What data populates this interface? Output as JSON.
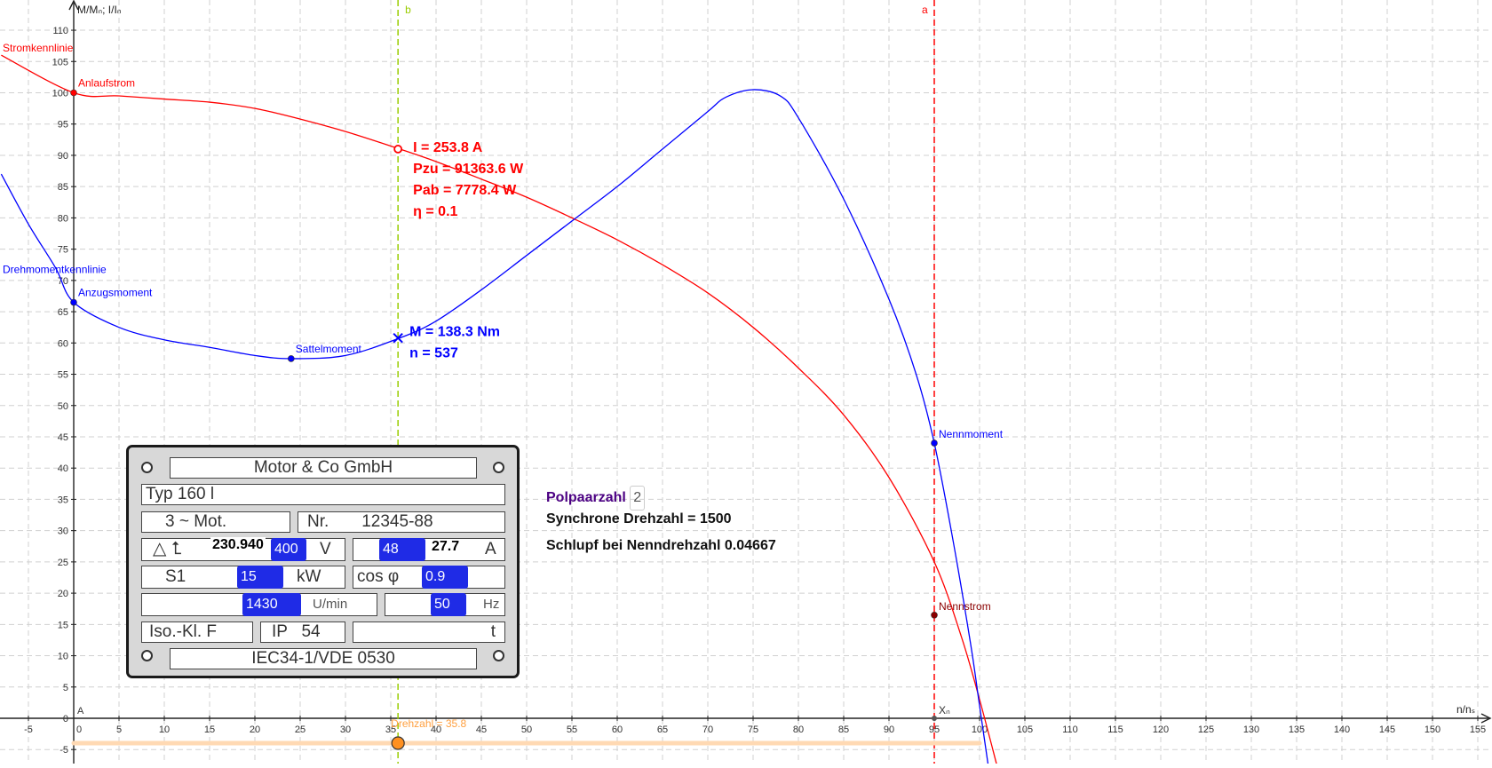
{
  "axes": {
    "y_label": "M/Mₙ; I/Iₙ",
    "x_label": "n/nₛ",
    "origin_label": "A",
    "x_range": [
      -8,
      157
    ],
    "y_range": [
      -8,
      114
    ],
    "x_ticks": [
      -5,
      0,
      5,
      10,
      15,
      20,
      25,
      30,
      35,
      40,
      45,
      50,
      55,
      60,
      65,
      70,
      75,
      80,
      85,
      90,
      95,
      100,
      105,
      110,
      115,
      120,
      125,
      130,
      135,
      140,
      145,
      150,
      155
    ],
    "y_ticks": [
      -5,
      0,
      5,
      10,
      15,
      20,
      25,
      30,
      35,
      40,
      45,
      50,
      55,
      60,
      65,
      70,
      75,
      80,
      85,
      90,
      95,
      100,
      105,
      110
    ]
  },
  "colors": {
    "current": "#ff0000",
    "torque": "#0000ff",
    "line_b": "#99cc00",
    "line_a": "#ff0000",
    "slider": "#ffa040",
    "polpaar": "#4b0082"
  },
  "curves": {
    "current": {
      "name": "Stromkennlinie",
      "points": [
        [
          -8,
          106
        ],
        [
          0,
          100
        ],
        [
          5,
          99.5
        ],
        [
          10,
          99
        ],
        [
          15,
          98.5
        ],
        [
          20,
          97.5
        ],
        [
          25,
          95.8
        ],
        [
          30,
          93.8
        ],
        [
          36,
          91
        ],
        [
          40,
          89
        ],
        [
          45,
          86.2
        ],
        [
          50,
          83.3
        ],
        [
          55,
          80
        ],
        [
          60,
          76.5
        ],
        [
          65,
          72.5
        ],
        [
          70,
          68
        ],
        [
          75,
          62.5
        ],
        [
          80,
          56
        ],
        [
          85,
          48.5
        ],
        [
          90,
          38.5
        ],
        [
          95,
          25
        ],
        [
          98,
          13
        ],
        [
          100,
          3
        ],
        [
          102,
          -8
        ]
      ]
    },
    "torque": {
      "name": "Drehmomentkennlinie",
      "points": [
        [
          -8,
          87
        ],
        [
          -5,
          79
        ],
        [
          -2,
          72
        ],
        [
          0,
          66.5
        ],
        [
          5,
          62.5
        ],
        [
          10,
          60.5
        ],
        [
          15,
          59.3
        ],
        [
          20,
          58
        ],
        [
          24,
          57.5
        ],
        [
          30,
          58
        ],
        [
          36,
          60.8
        ],
        [
          40,
          63.5
        ],
        [
          45,
          68.5
        ],
        [
          50,
          74
        ],
        [
          55,
          79.5
        ],
        [
          60,
          85
        ],
        [
          65,
          91
        ],
        [
          70,
          97
        ],
        [
          72,
          99.3
        ],
        [
          75,
          100.5
        ],
        [
          78,
          99.5
        ],
        [
          80,
          96
        ],
        [
          85,
          83
        ],
        [
          90,
          67
        ],
        [
          93,
          55
        ],
        [
          95,
          44
        ],
        [
          97,
          29
        ],
        [
          99,
          12
        ],
        [
          100,
          2
        ],
        [
          101,
          -8
        ]
      ]
    }
  },
  "points": {
    "anlaufstrom": {
      "label": "Anlaufstrom",
      "x": 0,
      "y": 100
    },
    "anzugsmoment": {
      "label": "Anzugsmoment",
      "x": 0,
      "y": 66.5
    },
    "sattelmoment": {
      "label": "Sattelmoment",
      "x": 24,
      "y": 57.5
    },
    "nennmoment": {
      "label": "Nennmoment",
      "x": 95,
      "y": 44
    },
    "nennstrom": {
      "label": "Nennstrom",
      "x": 95,
      "y": 16.5
    },
    "xn": {
      "label": "Xₙ",
      "x": 95,
      "y": 0
    },
    "current_marker": {
      "x": 35.8,
      "y": 91
    },
    "torque_marker": {
      "x": 35.8,
      "y": 60.8
    }
  },
  "lines": {
    "b": {
      "label": "b",
      "x": 35.8
    },
    "a": {
      "label": "a",
      "x": 95
    }
  },
  "slider": {
    "label": "Drehzahl = 35.8",
    "value": 35.8,
    "min": 0,
    "max": 100
  },
  "readouts": {
    "current": [
      "I = 253.8 A",
      "Pzu = 91363.6 W",
      "Pab = 7778.4 W",
      "η = 0.1"
    ],
    "torque": [
      "M = 138.3 Nm",
      "n = 537"
    ]
  },
  "info": {
    "polpaar_label": "Polpaarzahl",
    "polpaar_value": "2",
    "sync": "Synchrone Drehzahl = 1500",
    "schlupf": "Schlupf bei Nenndrehzahl 0.04667"
  },
  "plate": {
    "maker": "Motor & Co GmbH",
    "typ": "Typ    160 l",
    "mot": "3 ~ Mot.",
    "nr": "Nr.       12345-88",
    "delta_star": "△ ⮤",
    "voltage_calc": "230.940",
    "voltage": "400",
    "voltage_unit": "V",
    "current": "48",
    "current_calc": "27.7",
    "current_unit": "A",
    "s1": "S1",
    "power": "15",
    "power_unit": "kW",
    "cosphi_label": "cos φ",
    "cosphi": "0.9",
    "speed": "1430",
    "speed_unit": "U/min",
    "freq": "50",
    "freq_unit": "Hz",
    "iso": "Iso.-Kl. F",
    "ip": "IP   54",
    "t": "t",
    "norm": "IEC34-1/VDE 0530"
  }
}
